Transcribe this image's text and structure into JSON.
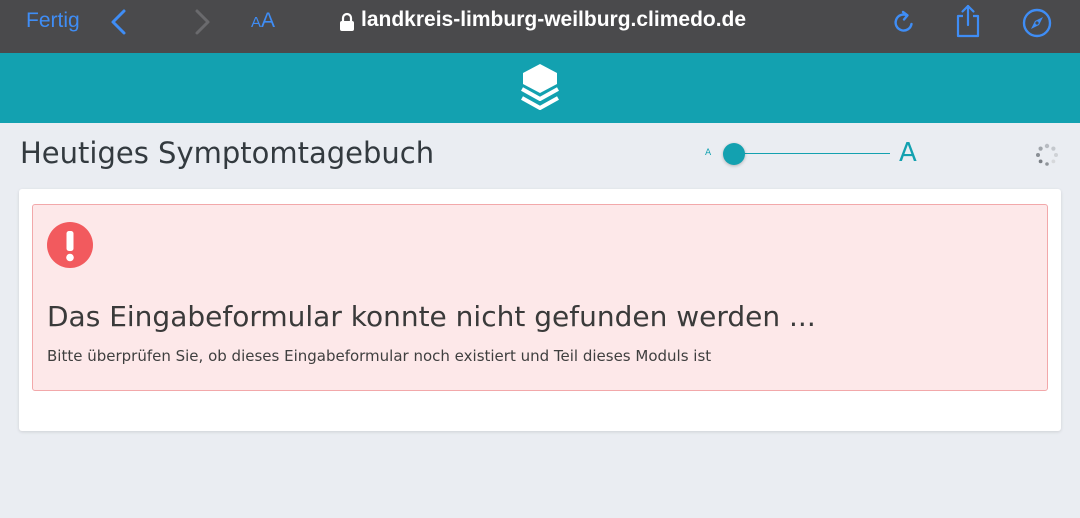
{
  "browser": {
    "done_label": "Fertig",
    "text_size_small": "A",
    "text_size_large": "A",
    "url": "landkreis-limburg-weilburg.climedo.de",
    "accent_color": "#3f8df5",
    "icons": [
      "back-icon",
      "forward-icon",
      "lock-icon",
      "reload-icon",
      "share-icon",
      "compass-icon"
    ]
  },
  "app": {
    "brand_color": "#13a1b0",
    "logo_icon": "layers-logo-icon"
  },
  "page": {
    "title": "Heutiges Symptomtagebuch",
    "font_size_small_label": "A",
    "font_size_large_label": "A",
    "font_size_level": 0,
    "loading_icon": "spinner-icon"
  },
  "alert": {
    "icon": "exclamation-circle-icon",
    "heading": "Das Eingabeformular konnte nicht gefunden werden ...",
    "message": "Bitte überprüfen Sie, ob dieses Eingabeformular noch existiert und Teil dieses Moduls ist",
    "icon_color": "#f25a5e",
    "background_color": "#fde8e9"
  }
}
